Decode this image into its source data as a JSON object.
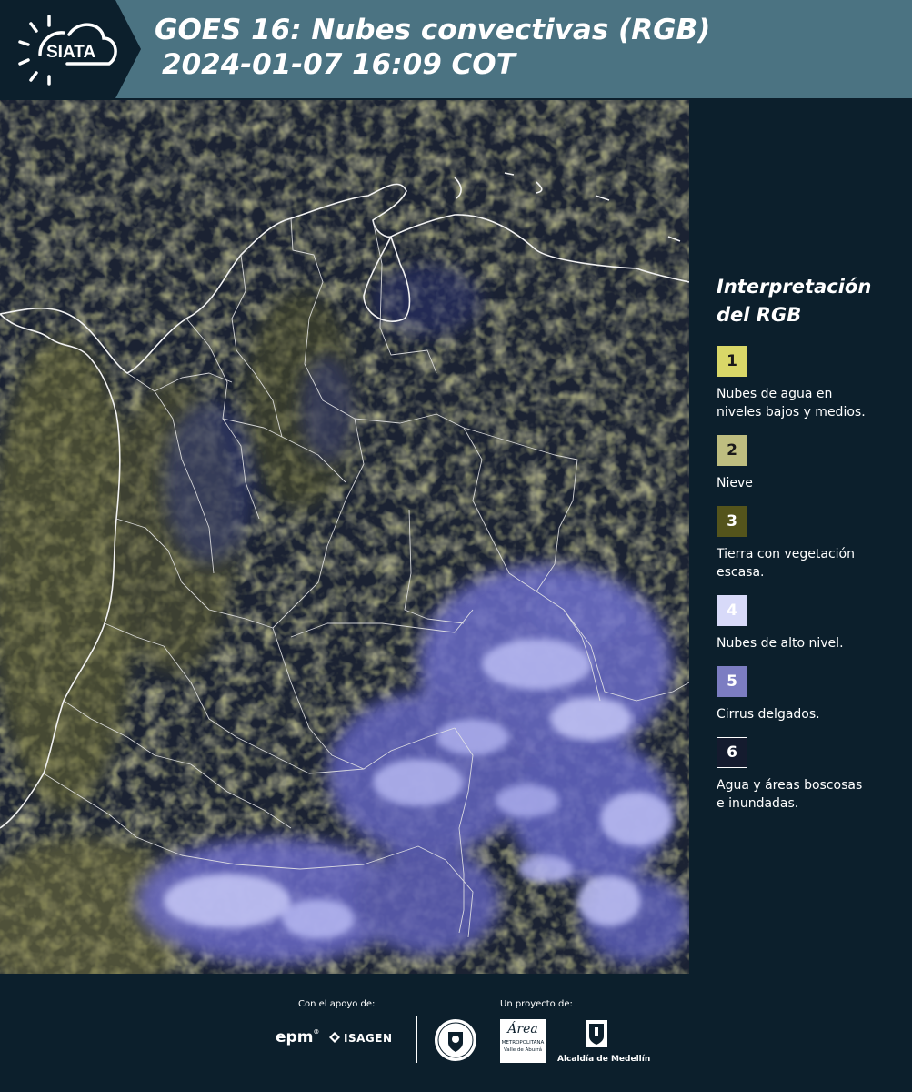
{
  "header": {
    "logo_text": "SIATA",
    "title_line1": "GOES 16: Nubes convectivas (RGB)",
    "title_line2": "2024-01-07 16:09 COT"
  },
  "legend": {
    "title_line1": "Interpretación",
    "title_line2": "del RGB",
    "items": [
      {
        "number": "1",
        "color": "#d9d768",
        "label_lines": [
          "Nubes de agua en",
          "niveles bajos y medios."
        ]
      },
      {
        "number": "2",
        "color": "#bebd80",
        "label_lines": [
          "Nieve"
        ]
      },
      {
        "number": "3",
        "color": "#54541c",
        "label_lines": [
          "Tierra con vegetación",
          "escasa."
        ]
      },
      {
        "number": "4",
        "color": "#d8daf9",
        "label_lines": [
          "Nubes de alto nivel."
        ]
      },
      {
        "number": "5",
        "color": "#7c7dc2",
        "label_lines": [
          "Cirrus delgados."
        ]
      },
      {
        "number": "6",
        "color": "#141b2e",
        "label_lines": [
          "Agua y áreas boscosas",
          "e inundadas."
        ]
      }
    ]
  },
  "footer": {
    "support_label": "Con el apoyo de:",
    "project_label": "Un proyecto de:",
    "sponsor1": "epm",
    "sponsor2": "ISAGEN",
    "partner1_line1": "Área",
    "partner1_line2": "METROPOLITANA",
    "partner1_line3": "Valle de Aburrá",
    "partner2": "Alcaldía de Medellín"
  }
}
